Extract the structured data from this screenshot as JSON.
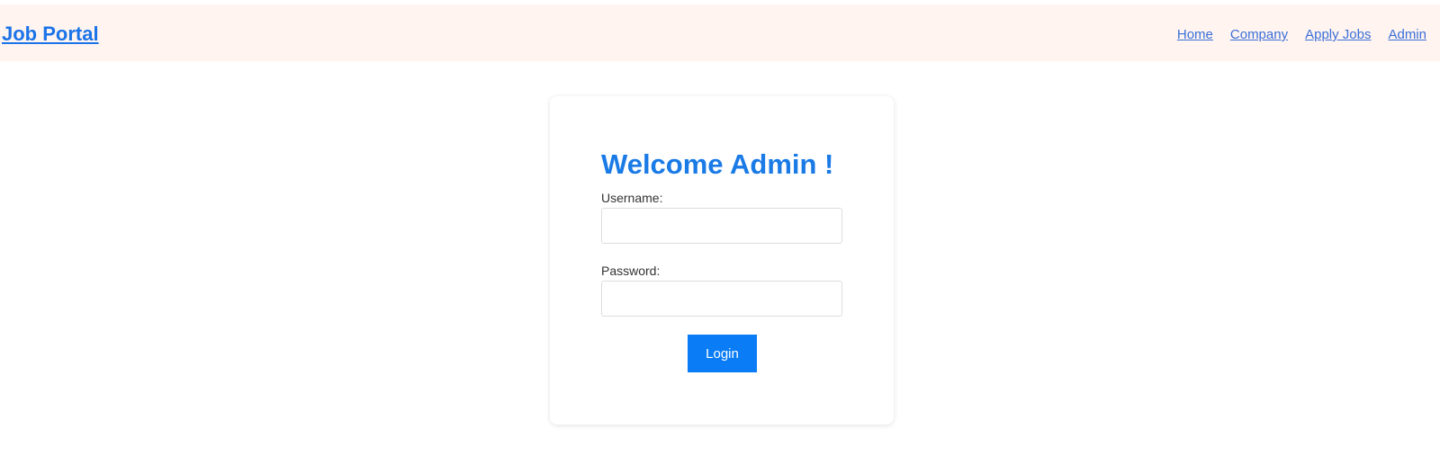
{
  "navbar": {
    "brand": "Job Portal",
    "links": [
      {
        "label": "Home"
      },
      {
        "label": "Company"
      },
      {
        "label": "Apply Jobs"
      },
      {
        "label": "Admin"
      }
    ]
  },
  "login_form": {
    "title": "Welcome Admin !",
    "username_label": "Username:",
    "username_value": "",
    "password_label": "Password:",
    "password_value": "",
    "submit_label": "Login"
  },
  "colors": {
    "navbar_bg": "#fff4f0",
    "link": "#3a6fd8",
    "title": "#1a7ae6",
    "button_bg": "#0a7cf5"
  }
}
